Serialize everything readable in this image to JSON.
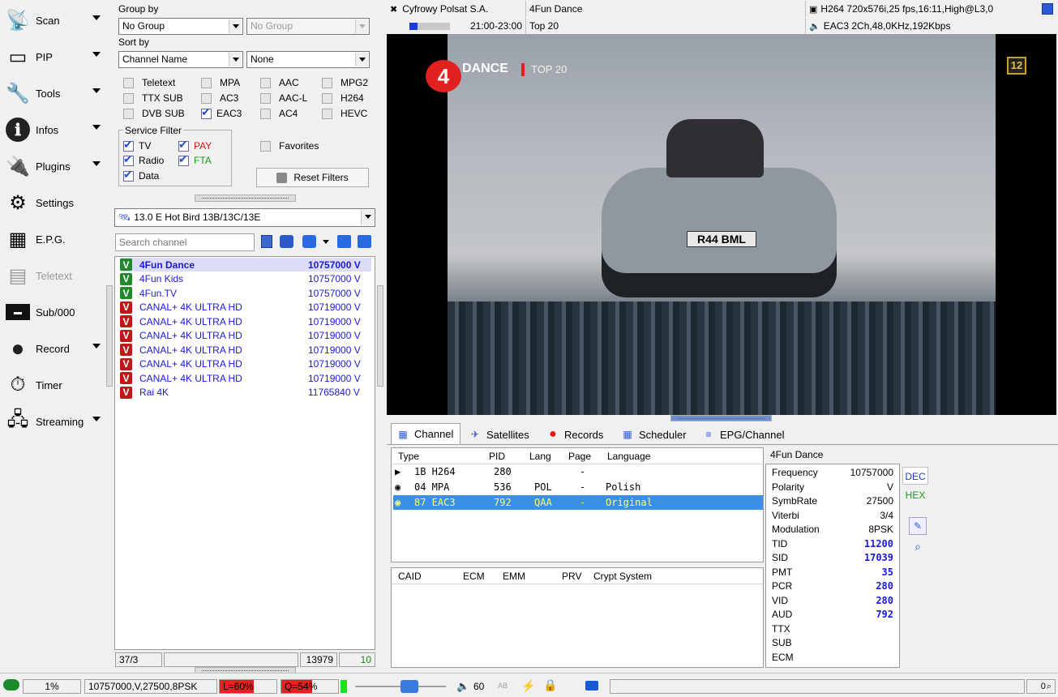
{
  "sidebar": {
    "items": [
      {
        "label": "Scan",
        "icon": "satellite-dish-icon",
        "arrow": true
      },
      {
        "label": "PIP",
        "icon": "pip-icon",
        "arrow": true
      },
      {
        "label": "Tools",
        "icon": "tools-icon",
        "arrow": true
      },
      {
        "label": "Infos",
        "icon": "info-icon",
        "arrow": true
      },
      {
        "label": "Plugins",
        "icon": "plugins-icon",
        "arrow": true
      },
      {
        "label": "Settings",
        "icon": "settings-icon",
        "arrow": false
      },
      {
        "label": "E.P.G.",
        "icon": "epg-icon",
        "arrow": false
      },
      {
        "label": "Teletext",
        "icon": "teletext-icon",
        "arrow": false
      },
      {
        "label": "Sub/000",
        "icon": "subtitle-icon",
        "arrow": false
      },
      {
        "label": "Record",
        "icon": "record-icon",
        "arrow": true
      },
      {
        "label": "Timer",
        "icon": "timer-icon",
        "arrow": false
      },
      {
        "label": "Streaming",
        "icon": "streaming-icon",
        "arrow": true
      }
    ]
  },
  "filters": {
    "group_by_label": "Group by",
    "group_by_value": "No Group",
    "group_by_secondary": "No Group",
    "sort_by_label": "Sort by",
    "sort_by_value": "Channel Name",
    "sort_by_secondary": "None",
    "codecs": [
      {
        "label": "Teletext",
        "checked": false
      },
      {
        "label": "MPA",
        "checked": false
      },
      {
        "label": "AAC",
        "checked": false
      },
      {
        "label": "MPG2",
        "checked": false
      },
      {
        "label": "TTX SUB",
        "checked": false
      },
      {
        "label": "AC3",
        "checked": false
      },
      {
        "label": "AAC-L",
        "checked": false
      },
      {
        "label": "H264",
        "checked": false
      },
      {
        "label": "DVB SUB",
        "checked": false
      },
      {
        "label": "EAC3",
        "checked": true
      },
      {
        "label": "AC4",
        "checked": false
      },
      {
        "label": "HEVC",
        "checked": false
      }
    ],
    "service_filter_label": "Service Filter",
    "service": {
      "tv": "TV",
      "pay": "PAY",
      "radio": "Radio",
      "fta": "FTA",
      "data": "Data"
    },
    "favorites_label": "Favorites",
    "reset_label": "Reset Filters"
  },
  "satellite": "13.0 E Hot Bird 13B/13C/13E",
  "search_placeholder": "Search channel",
  "channels": [
    {
      "name": "4Fun Dance",
      "freq": "10757000 V",
      "type": "V",
      "color": "green"
    },
    {
      "name": "4Fun Kids",
      "freq": "10757000 V",
      "type": "V",
      "color": "green"
    },
    {
      "name": "4Fun.TV",
      "freq": "10757000 V",
      "type": "V",
      "color": "green"
    },
    {
      "name": "CANAL+ 4K ULTRA HD",
      "freq": "10719000 V",
      "type": "V",
      "color": "red"
    },
    {
      "name": "CANAL+ 4K ULTRA HD",
      "freq": "10719000 V",
      "type": "V",
      "color": "red"
    },
    {
      "name": "CANAL+ 4K ULTRA HD",
      "freq": "10719000 V",
      "type": "V",
      "color": "red"
    },
    {
      "name": "CANAL+ 4K ULTRA HD",
      "freq": "10719000 V",
      "type": "V",
      "color": "red"
    },
    {
      "name": "CANAL+ 4K ULTRA HD",
      "freq": "10719000 V",
      "type": "V",
      "color": "red"
    },
    {
      "name": "CANAL+ 4K ULTRA HD",
      "freq": "10719000 V",
      "type": "V",
      "color": "red"
    },
    {
      "name": "Rai 4K",
      "freq": "11765840 V",
      "type": "V",
      "color": "red"
    }
  ],
  "list_status": {
    "count": "37/3",
    "number": "13979",
    "right": "10"
  },
  "now": {
    "provider": "Cyfrowy Polsat S.A.",
    "channel": "4Fun Dance",
    "video_info": "H264 720x576i,25 fps,16:11,High@L3,0",
    "time": "21:00-23:00",
    "program": "Top 20",
    "audio_info": "EAC3 2Ch,48,0KHz,192Kbps",
    "progress": 0.2
  },
  "video": {
    "logo_text": "DANCE",
    "logo_num": "4",
    "subtitle": "TOP 20",
    "rating": "12",
    "plate": "R44 BML"
  },
  "tabs": [
    {
      "label": "Channel",
      "active": true
    },
    {
      "label": "Satellites",
      "active": false
    },
    {
      "label": "Records",
      "active": false
    },
    {
      "label": "Scheduler",
      "active": false
    },
    {
      "label": "EPG/Channel",
      "active": false
    }
  ],
  "streams": {
    "headers": [
      "Type",
      "PID",
      "Lang",
      "Page",
      "Language"
    ],
    "rows": [
      {
        "type": "1B H264",
        "pid": "280",
        "lang": "",
        "page": "-",
        "language": "",
        "selected": false
      },
      {
        "type": "04 MPA",
        "pid": "536",
        "lang": "POL",
        "page": "-",
        "language": "Polish",
        "selected": false
      },
      {
        "type": "87 EAC3",
        "pid": "792",
        "lang": "QAA",
        "page": "-",
        "language": "Original",
        "selected": true
      }
    ]
  },
  "crypt": {
    "headers": [
      "CAID",
      "ECM",
      "EMM",
      "PRV",
      "Crypt System"
    ]
  },
  "info": {
    "title": "4Fun Dance",
    "rows": [
      {
        "k": "Frequency",
        "v": "10757000",
        "blue": false
      },
      {
        "k": "Polarity",
        "v": "V",
        "blue": false
      },
      {
        "k": "SymbRate",
        "v": "27500",
        "blue": false
      },
      {
        "k": "Viterbi",
        "v": "3/4",
        "blue": false
      },
      {
        "k": "Modulation",
        "v": "8PSK",
        "blue": false
      },
      {
        "k": "TID",
        "v": "11200",
        "blue": true
      },
      {
        "k": "SID",
        "v": "17039",
        "blue": true
      },
      {
        "k": "PMT",
        "v": "35",
        "blue": true
      },
      {
        "k": "PCR",
        "v": "280",
        "blue": true
      },
      {
        "k": "VID",
        "v": "280",
        "blue": true
      },
      {
        "k": "AUD",
        "v": "792",
        "blue": true
      },
      {
        "k": "TTX",
        "v": "",
        "blue": false
      },
      {
        "k": "SUB",
        "v": "",
        "blue": false
      },
      {
        "k": "ECM",
        "v": "",
        "blue": false
      }
    ],
    "dec": "DEC",
    "hex": "HEX"
  },
  "status": {
    "percent": "1%",
    "transponder": "10757000,V,27500,8PSK",
    "level": "L=60%",
    "quality": "Q=54%",
    "volume": "60",
    "ab": "AB",
    "zoom": "0"
  }
}
